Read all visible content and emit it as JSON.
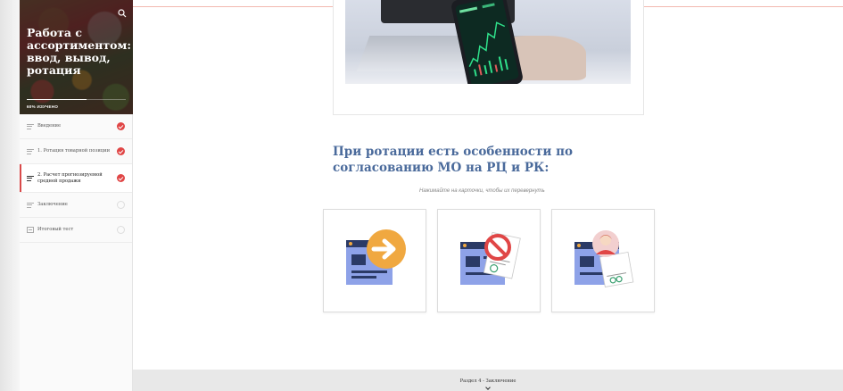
{
  "sidebar": {
    "course_title": "Работа с ассортиментом: ввод, вывод, ротация",
    "progress_label": "60% ИЗУЧЕНО",
    "progress_value": 0.6,
    "items": [
      {
        "label": "Введение",
        "status": "complete"
      },
      {
        "label": "1. Ротация товарной позиции",
        "status": "complete"
      },
      {
        "label": "2. Расчет прогнозируемой средней продажи",
        "status": "complete"
      },
      {
        "label": "Заключение",
        "status": "incomplete"
      },
      {
        "label": "Итоговый тест",
        "status": "incomplete"
      }
    ]
  },
  "main": {
    "heading": "При ротации есть особенности по согласованию МО на РЦ и РК:",
    "hint": "Нажимайте на карточки, чтобы их перевернуть",
    "cards": [
      {
        "icon": "document-arrow-icon"
      },
      {
        "icon": "document-prohibited-icon"
      },
      {
        "icon": "document-person-icon"
      }
    ]
  },
  "footer": {
    "next_section": "Раздел 4 - Заключение"
  },
  "colors": {
    "accent_red": "#e04646",
    "heading_blue": "#4a6a9b",
    "doc_blue": "#8ea2e8",
    "arrow_orange": "#f0a840"
  }
}
